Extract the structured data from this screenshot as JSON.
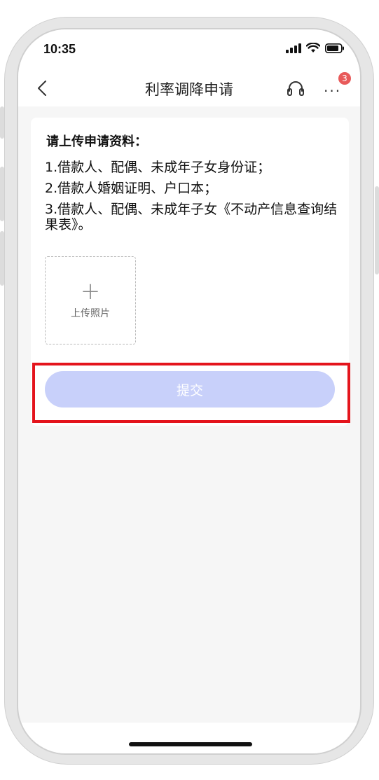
{
  "status_bar": {
    "time": "10:35"
  },
  "nav": {
    "title": "利率调降申请",
    "badge_count": "3",
    "more_label": "···"
  },
  "card": {
    "heading": "请上传申请资料：",
    "requirements": [
      "1.借款人、配偶、未成年子女身份证；",
      "2.借款人婚姻证明、户口本；",
      "3.借款人、配偶、未成年子女《不动产信息查询结果表》。"
    ],
    "upload": {
      "plus": "+",
      "label": "上传照片"
    },
    "submit_label": "提交"
  },
  "colors": {
    "submit_bg": "#c8d0fa",
    "highlight": "#e4141c",
    "badge": "#e85a5a"
  }
}
